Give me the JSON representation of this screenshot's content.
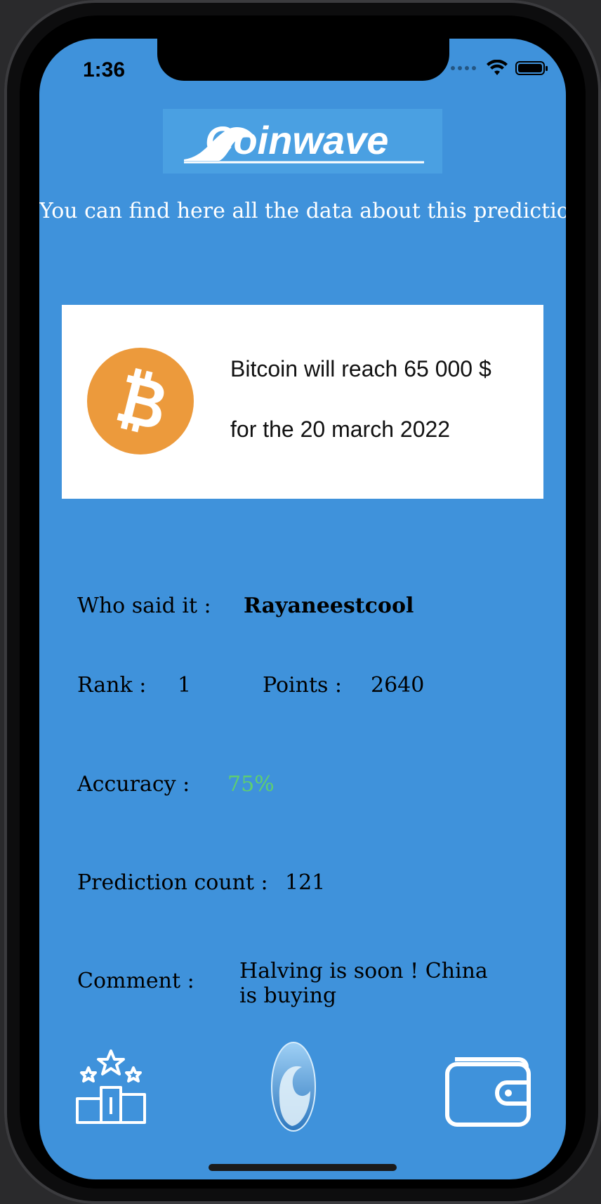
{
  "status_bar": {
    "time": "1:36"
  },
  "header": {
    "logo_text": "Coinwave",
    "subtitle": "You can find here all the data about this prediction"
  },
  "prediction": {
    "coin_icon": "bitcoin-icon",
    "line1": "Bitcoin will reach 65 000 $",
    "line2": "for the 20 march 2022"
  },
  "details": {
    "author_label": "Who said it :",
    "author_value": "Rayaneestcool",
    "rank_label": "Rank :",
    "rank_value": "1",
    "points_label": "Points :",
    "points_value": "2640",
    "accuracy_label": "Accuracy :",
    "accuracy_value": "75%",
    "count_label": "Prediction count :",
    "count_value": "121",
    "comment_label": "Comment :",
    "comment_value": "Halving is soon ! China is buying"
  },
  "tab_bar": {
    "items": [
      {
        "icon": "leaderboard-podium-icon"
      },
      {
        "icon": "coinwave-wave-icon"
      },
      {
        "icon": "wallet-icon"
      }
    ]
  },
  "colors": {
    "background": "#3f92db",
    "card": "#ffffff",
    "bitcoin": "#ec9a3c",
    "accuracy": "#5fd06d"
  }
}
